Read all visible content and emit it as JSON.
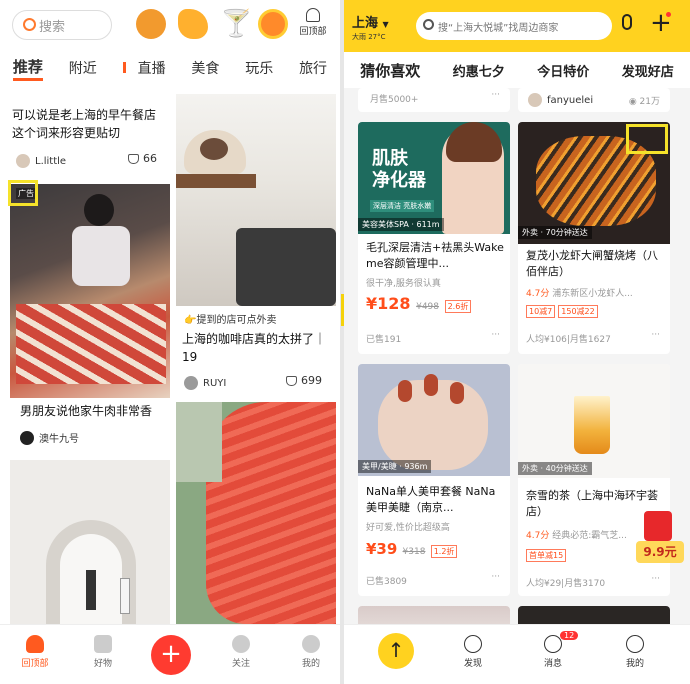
{
  "left": {
    "search_placeholder": "搜索",
    "back_to_top": "回顶部",
    "tabs": [
      "推荐",
      "附近",
      "直播",
      "美食",
      "玩乐",
      "旅行"
    ],
    "cards": [
      {
        "title": "可以说是老上海的早午餐店 这个词来形容更贴切",
        "author": "L.little",
        "likes": "66"
      },
      {
        "ad_tag": "广告",
        "title": "男朋友说他家牛肉非常香",
        "author": "澳牛九号"
      },
      {
        "title": "上海的咖啡店真的太拼了｜19",
        "promo": "提到的店可点外卖",
        "author": "RUYI",
        "likes": "699"
      },
      {
        "title": "..."
      }
    ],
    "bottom_nav": [
      "回顶部",
      "好物",
      "",
      "关注",
      "我的"
    ],
    "accent": "#ff5a1f"
  },
  "right": {
    "city": "上海",
    "weather": "大雨 27°C",
    "search_placeholder": "搜“上海大悦城”找周边商家",
    "tabs": [
      "猜你喜欢",
      "约惠七夕",
      "今日特价",
      "发现好店"
    ],
    "top_left": {
      "sales": "月售5000+"
    },
    "top_right": {
      "author": "fanyuelei",
      "views": "21万"
    },
    "cards": [
      {
        "image_text": "肌肤\n净化器",
        "banner": "深层清洁 亮肤水嫩",
        "tag": "美容美体SPA · 611m",
        "title": "毛孔深层清洁+祛黑头Wake me容颜管理中...",
        "desc": "很干净,服务很认真",
        "price": "¥128",
        "orig": "¥498",
        "discount": "2.6折",
        "sales": "已售191"
      },
      {
        "tag": "外卖 · 70分钟送达",
        "title": "复茂小龙虾大闸蟹烧烤（八佰伴店）",
        "rating": "4.7分",
        "area": "浦东新区小龙虾人...",
        "promos": [
          "10减7",
          "150减22"
        ],
        "summary": "人均¥106|月售1627"
      },
      {
        "tag": "美甲/美睫 · 936m",
        "title": "NaNa单人美甲套餐 NaNa美甲美睫（南京...",
        "desc": "好可爱,性价比超级高",
        "price": "¥39",
        "orig": "¥318",
        "discount": "1.2折",
        "sales": "已售3809"
      },
      {
        "tag": "外卖 · 40分钟送达",
        "title": "奈雪的茶（上海中海环宇荟店）",
        "rating": "4.7分",
        "area": "经典必范:霸气芝...",
        "promos": [
          "首单减15"
        ],
        "summary": "人均¥29|月售3170",
        "red_packet": "9.9元"
      }
    ],
    "bottom_nav": [
      "",
      "发现",
      "消息",
      "我的"
    ],
    "message_badge": "12",
    "accent": "#ffd21f"
  }
}
